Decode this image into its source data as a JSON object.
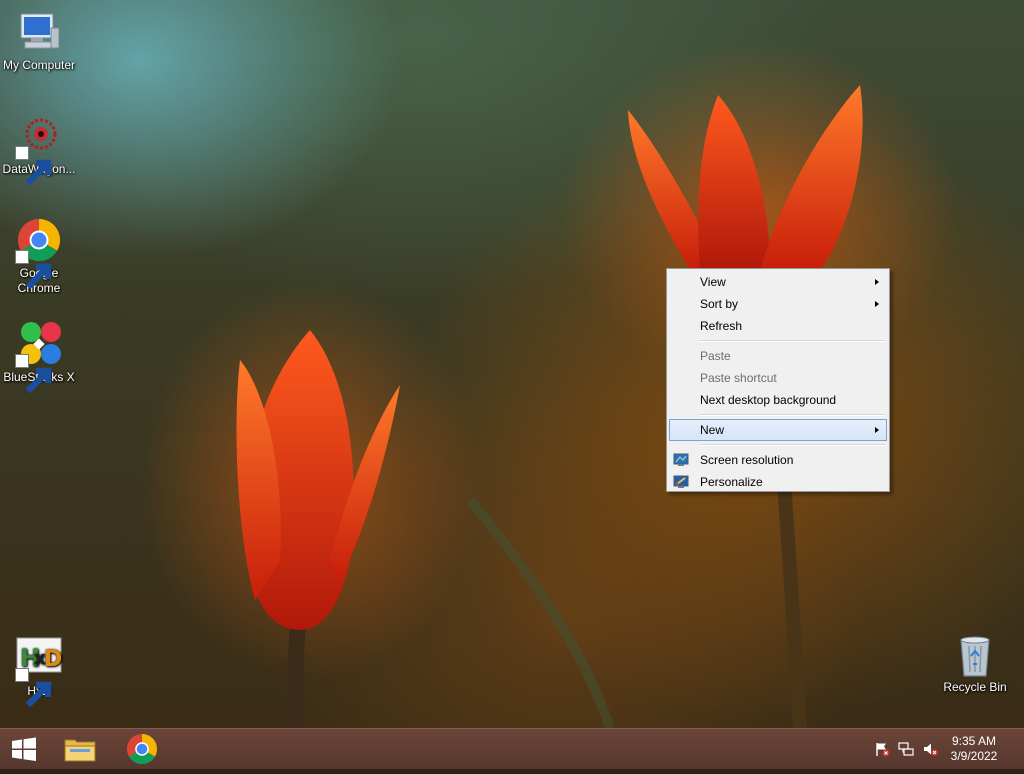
{
  "desktop": {
    "icons": [
      {
        "label": "My Computer",
        "icon": "computer-icon"
      },
      {
        "label": "DataWagon...",
        "icon": "datawagon-icon"
      },
      {
        "label": "Google Chrome",
        "icon": "chrome-icon"
      },
      {
        "label": "BlueStacks X",
        "icon": "bluestacks-icon"
      },
      {
        "label": "HxD",
        "icon": "hxd-icon"
      },
      {
        "label": "Recycle Bin",
        "icon": "recycle-bin-icon"
      }
    ]
  },
  "context_menu": {
    "items": [
      {
        "label": "View",
        "submenu": true,
        "enabled": true
      },
      {
        "label": "Sort by",
        "submenu": true,
        "enabled": true
      },
      {
        "label": "Refresh",
        "submenu": false,
        "enabled": true
      },
      {
        "label": "Paste",
        "submenu": false,
        "enabled": false
      },
      {
        "label": "Paste shortcut",
        "submenu": false,
        "enabled": false
      },
      {
        "label": "Next desktop background",
        "submenu": false,
        "enabled": true
      },
      {
        "label": "New",
        "submenu": true,
        "enabled": true,
        "highlighted": true
      },
      {
        "label": "Screen resolution",
        "icon": "display-icon",
        "enabled": true
      },
      {
        "label": "Personalize",
        "icon": "personalize-icon",
        "enabled": true
      }
    ]
  },
  "taskbar": {
    "pinned": [
      "start-icon",
      "file-explorer-icon",
      "chrome-icon"
    ],
    "tray": [
      "action-center-flag-icon",
      "network-icon",
      "volume-muted-icon"
    ],
    "clock": {
      "time": "9:35 AM",
      "date": "3/9/2022"
    }
  },
  "colors": {
    "menu_bg": "#f0f0f0",
    "menu_highlight": "#d7e5f8",
    "menu_highlight_border": "#7da2ce",
    "taskbar": "#6e463a"
  }
}
